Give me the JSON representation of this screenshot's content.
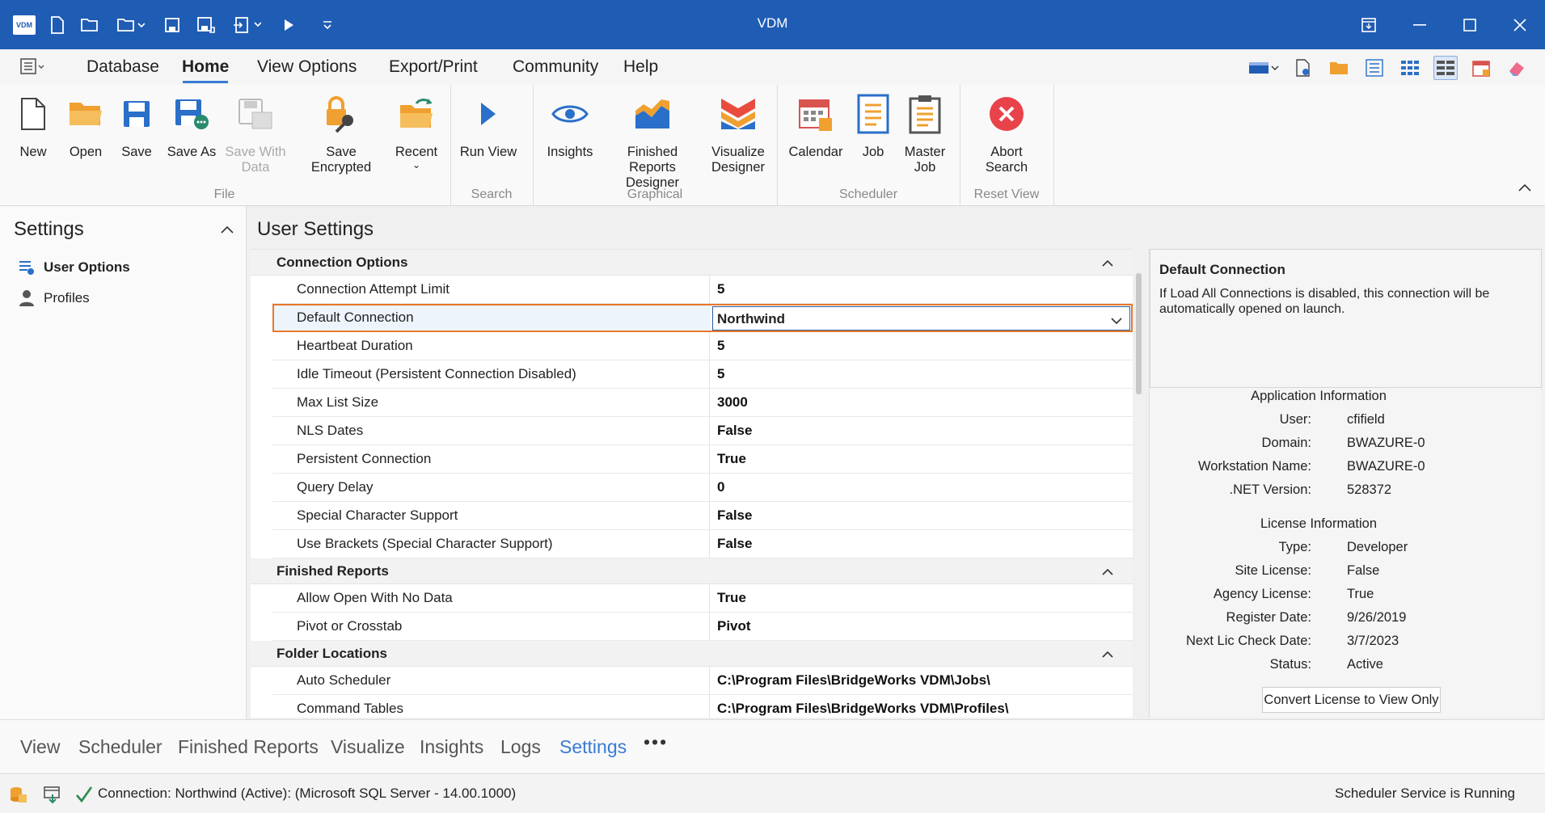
{
  "window": {
    "title": "VDM",
    "logo_text": "VDM"
  },
  "menu": {
    "items": [
      "Database",
      "Home",
      "View Options",
      "Export/Print",
      "Community",
      "Help"
    ],
    "active": "Home"
  },
  "ribbon": {
    "buttons": {
      "new": "New",
      "open": "Open",
      "save": "Save",
      "save_as": "Save As",
      "save_with_data": "Save With Data",
      "save_encrypted": "Save Encrypted",
      "recent": "Recent",
      "run_view": "Run View",
      "insights": "Insights",
      "finished_reports_designer": "Finished Reports Designer",
      "visualize_designer": "Visualize Designer",
      "calendar": "Calendar",
      "job": "Job",
      "master_job": "Master Job",
      "abort_search": "Abort Search"
    },
    "groups": {
      "file": "File",
      "search": "Search",
      "graphical": "Graphical",
      "scheduler": "Scheduler",
      "reset_view": "Reset View"
    }
  },
  "settings_panel": {
    "title": "Settings",
    "items": [
      "User Options",
      "Profiles"
    ],
    "selected": "User Options"
  },
  "main": {
    "title": "User Settings"
  },
  "grid": {
    "categories": [
      "Connection Options",
      "Finished Reports",
      "Folder Locations"
    ],
    "connection_options": [
      {
        "name": "Connection Attempt Limit",
        "value": "5"
      },
      {
        "name": "Default Connection",
        "value": "Northwind"
      },
      {
        "name": "Heartbeat Duration",
        "value": "5"
      },
      {
        "name": "Idle Timeout (Persistent Connection Disabled)",
        "value": "5"
      },
      {
        "name": "Max List Size",
        "value": "3000"
      },
      {
        "name": "NLS Dates",
        "value": "False"
      },
      {
        "name": "Persistent Connection",
        "value": "True"
      },
      {
        "name": "Query Delay",
        "value": "0"
      },
      {
        "name": "Special Character Support",
        "value": "False"
      },
      {
        "name": "Use Brackets (Special Character Support)",
        "value": "False"
      }
    ],
    "finished_reports": [
      {
        "name": "Allow Open With No Data",
        "value": "True"
      },
      {
        "name": "Pivot or Crosstab",
        "value": "Pivot"
      }
    ],
    "folder_locations": [
      {
        "name": "Auto Scheduler",
        "value": "C:\\Program Files\\BridgeWorks VDM\\Jobs\\"
      },
      {
        "name": "Command Tables",
        "value": "C:\\Program Files\\BridgeWorks VDM\\Profiles\\"
      }
    ]
  },
  "description": {
    "title": "Default Connection",
    "text": "If Load All Connections is disabled, this connection will be automatically opened on launch."
  },
  "app_info": {
    "heading": "Application Information",
    "rows": [
      {
        "k": "User:",
        "v": "cfifield"
      },
      {
        "k": "Domain:",
        "v": "BWAZURE-0"
      },
      {
        "k": "Workstation Name:",
        "v": "BWAZURE-0"
      },
      {
        "k": ".NET Version:",
        "v": "528372"
      }
    ]
  },
  "license_info": {
    "heading": "License Information",
    "rows": [
      {
        "k": "Type:",
        "v": "Developer"
      },
      {
        "k": "Site License:",
        "v": "False"
      },
      {
        "k": "Agency License:",
        "v": "True"
      },
      {
        "k": "Register Date:",
        "v": "9/26/2019"
      },
      {
        "k": "Next Lic Check Date:",
        "v": "3/7/2023"
      },
      {
        "k": "Status:",
        "v": "Active"
      }
    ],
    "button": "Convert License to View Only"
  },
  "bottom_nav": {
    "items": [
      "View",
      "Scheduler",
      "Finished Reports",
      "Visualize",
      "Insights",
      "Logs",
      "Settings"
    ],
    "active": "Settings",
    "more": "•••"
  },
  "status_bar": {
    "connection": "Connection: Northwind (Active): (Microsoft SQL Server - 14.00.1000)",
    "scheduler": "Scheduler Service is Running"
  },
  "colors": {
    "titlebar": "#1f5cb4",
    "accent": "#3a7bd5",
    "highlight": "#e8782a",
    "ribbon_orange": "#f0a030",
    "ribbon_blue": "#2a6fc9"
  }
}
